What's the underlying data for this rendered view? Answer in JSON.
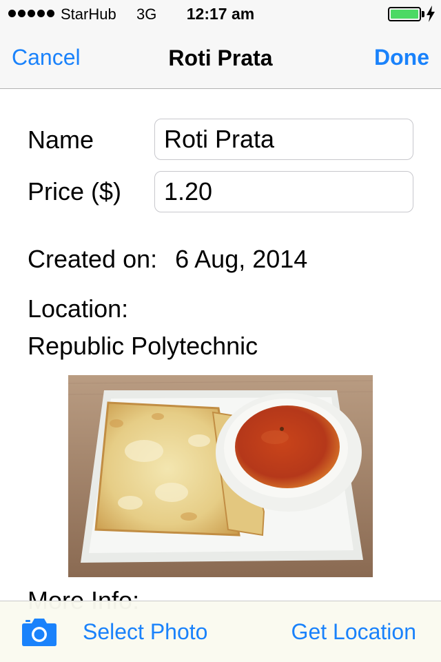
{
  "status_bar": {
    "carrier": "StarHub",
    "network": "3G",
    "time": "12:17 am",
    "signal_icon": "signal-dots-icon",
    "battery_icon": "battery-icon",
    "charging_icon": "bolt-icon",
    "battery_level": 1.0,
    "battery_color": "#4cd964"
  },
  "nav": {
    "cancel_label": "Cancel",
    "title": "Roti Prata",
    "done_label": "Done",
    "accent_color": "#1a82fb"
  },
  "form": {
    "name_label": "Name",
    "name_value": "Roti Prata",
    "price_label": "Price ($)",
    "price_value": "1.20",
    "created_label": "Created on:",
    "created_value": "6 Aug, 2014",
    "location_label": "Location:",
    "location_value": "Republic Polytechnic",
    "photo_icon": "food-photo",
    "more_info_label": "More Info:"
  },
  "toolbar": {
    "camera_icon": "camera-icon",
    "select_photo_label": "Select Photo",
    "get_location_label": "Get Location"
  }
}
